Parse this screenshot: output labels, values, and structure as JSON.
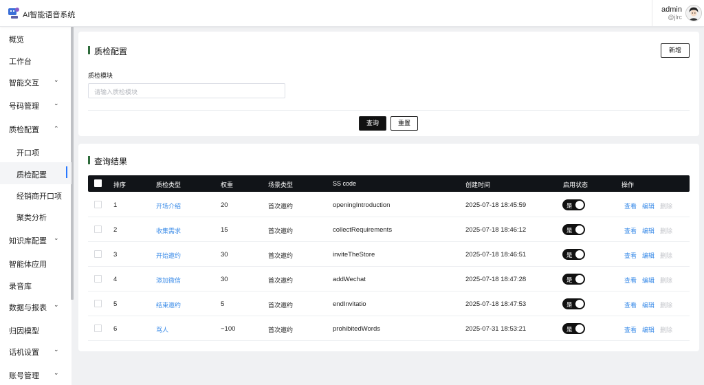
{
  "app": {
    "title": "AI智能语音系统"
  },
  "user": {
    "name": "admin",
    "handle": "@jlrc"
  },
  "sidebar": {
    "items": [
      {
        "label": "概览",
        "chevron": ""
      },
      {
        "label": "工作台",
        "chevron": ""
      },
      {
        "label": "智能交互",
        "chevron": "⌄"
      },
      {
        "label": "号码管理",
        "chevron": "⌄"
      },
      {
        "label": "质检配置",
        "chevron": "⌃"
      },
      {
        "label": "开口项",
        "chevron": ""
      },
      {
        "label": "质检配置",
        "chevron": ""
      },
      {
        "label": "经销商开口项",
        "chevron": ""
      },
      {
        "label": "聚类分析",
        "chevron": ""
      },
      {
        "label": "知识库配置",
        "chevron": "⌄"
      },
      {
        "label": "智能体应用",
        "chevron": ""
      },
      {
        "label": "录音库",
        "chevron": ""
      },
      {
        "label": "数据与报表",
        "chevron": "⌄"
      },
      {
        "label": "归因模型",
        "chevron": ""
      },
      {
        "label": "话机设置",
        "chevron": "⌄"
      },
      {
        "label": "账号管理",
        "chevron": "⌄"
      }
    ]
  },
  "filter": {
    "title": "质检配置",
    "add_label": "新增",
    "field_label": "质检模块",
    "field_placeholder": "请输入质检模块",
    "query_label": "查询",
    "reset_label": "重置"
  },
  "results": {
    "title": "查询结果",
    "columns": [
      "排序",
      "质检类型",
      "权重",
      "场景类型",
      "SS code",
      "创建时间",
      "启用状态",
      "操作"
    ],
    "rows": [
      {
        "order": "1",
        "type": "开场介绍",
        "weight": "20",
        "scene": "首次邀约",
        "code": "openingIntroduction",
        "created": "2025-07-18 18:45:59",
        "status": "是"
      },
      {
        "order": "2",
        "type": "收集需求",
        "weight": "15",
        "scene": "首次邀约",
        "code": "collectRequirements",
        "created": "2025-07-18 18:46:12",
        "status": "是"
      },
      {
        "order": "3",
        "type": "开始邀约",
        "weight": "30",
        "scene": "首次邀约",
        "code": "inviteTheStore",
        "created": "2025-07-18 18:46:51",
        "status": "是"
      },
      {
        "order": "4",
        "type": "添加微信",
        "weight": "30",
        "scene": "首次邀约",
        "code": "addWechat",
        "created": "2025-07-18 18:47:28",
        "status": "是"
      },
      {
        "order": "5",
        "type": "结束邀约",
        "weight": "5",
        "scene": "首次邀约",
        "code": "endInvitatio",
        "created": "2025-07-18 18:47:53",
        "status": "是"
      },
      {
        "order": "6",
        "type": "骂人",
        "weight": "−100",
        "scene": "首次邀约",
        "code": "prohibitedWords",
        "created": "2025-07-31 18:53:21",
        "status": "是"
      }
    ],
    "actions": {
      "view": "查看",
      "edit": "编辑",
      "delete": "删除"
    }
  }
}
